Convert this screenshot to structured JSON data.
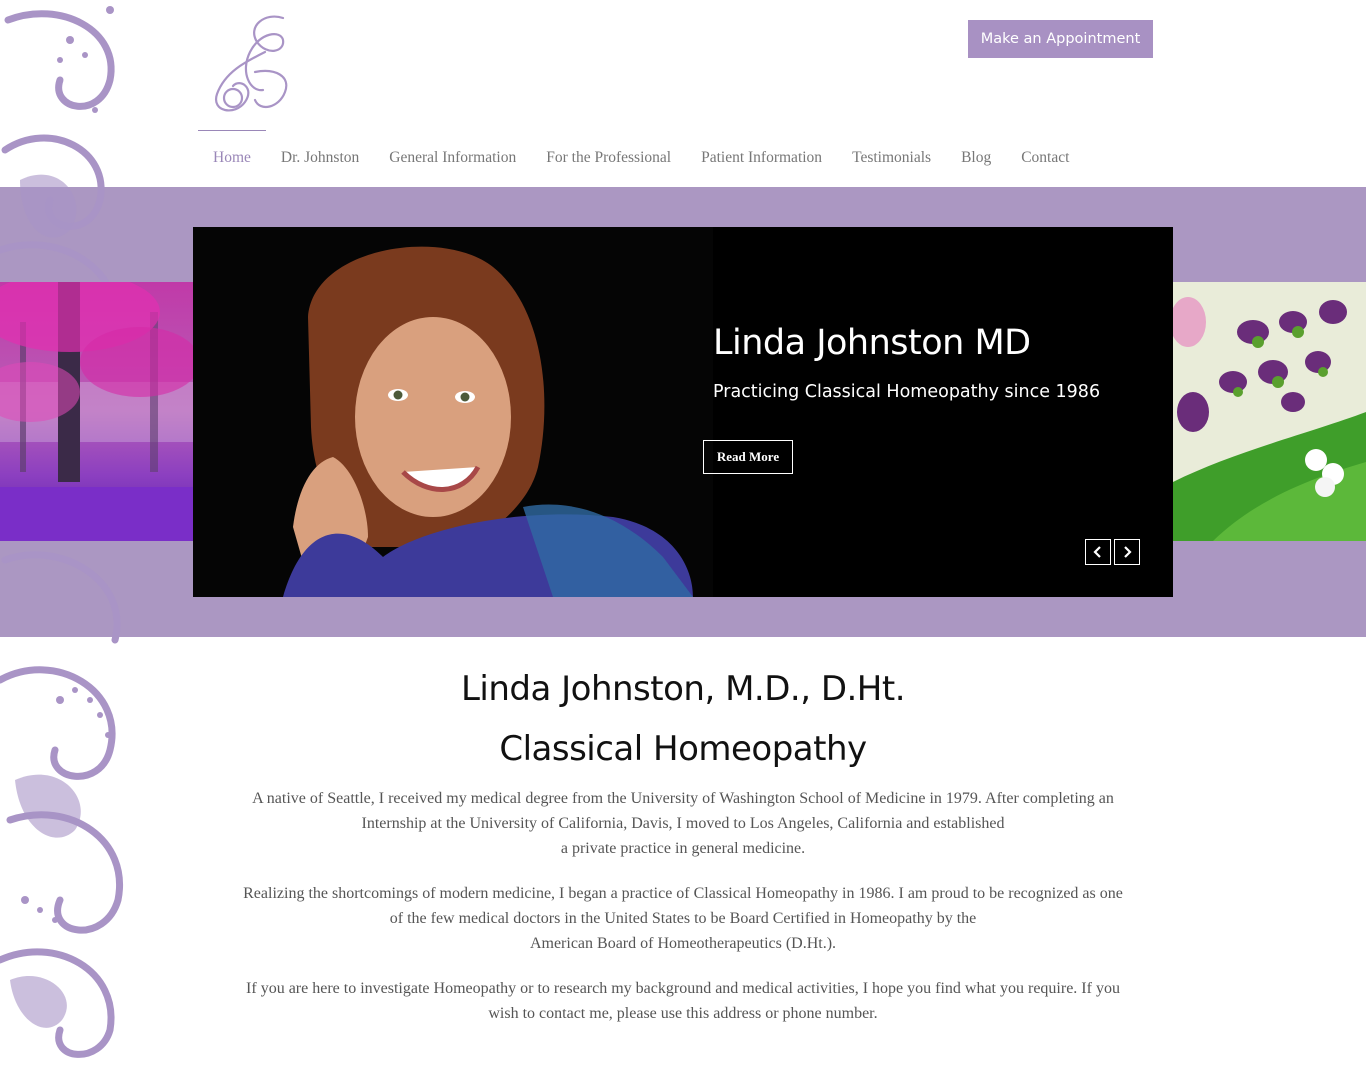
{
  "header": {
    "appointment_label": "Make an Appointment"
  },
  "nav": {
    "items": [
      {
        "label": "Home",
        "active": true
      },
      {
        "label": "Dr. Johnston"
      },
      {
        "label": "General Information"
      },
      {
        "label": "For the Professional"
      },
      {
        "label": "Patient Information"
      },
      {
        "label": "Testimonials"
      },
      {
        "label": "Blog"
      },
      {
        "label": "Contact"
      }
    ]
  },
  "hero": {
    "title": "Linda Johnston MD",
    "subtitle": "Practicing Classical Homeopathy since 1986",
    "button_label": "Read More"
  },
  "main": {
    "heading_1": "Linda Johnston, M.D., D.Ht.",
    "heading_2": "Classical Homeopathy",
    "paragraphs": [
      {
        "lines": [
          "A native of Seattle, I received my medical degree from the University of Washington School of Medicine in 1979. After completing an",
          "Internship at the University of California, Davis, I moved to Los Angeles, California and established",
          "a private practice in general medicine."
        ]
      },
      {
        "lines": [
          "Realizing the shortcomings of modern medicine, I began a practice of Classical Homeopathy in 1986. I am proud to be recognized as one",
          "of the few medical doctors in the United States to be Board Certified in Homeopathy by the",
          "American Board of Homeotherapeutics (D.Ht.)."
        ]
      },
      {
        "lines": [
          "If you are here to investigate Homeopathy or to research my background and medical activities, I hope you find what you require. If you",
          "wish to contact me, please use this address or phone number."
        ]
      }
    ]
  },
  "colors": {
    "accent": "#ab97c2",
    "button": "#a891c3"
  }
}
